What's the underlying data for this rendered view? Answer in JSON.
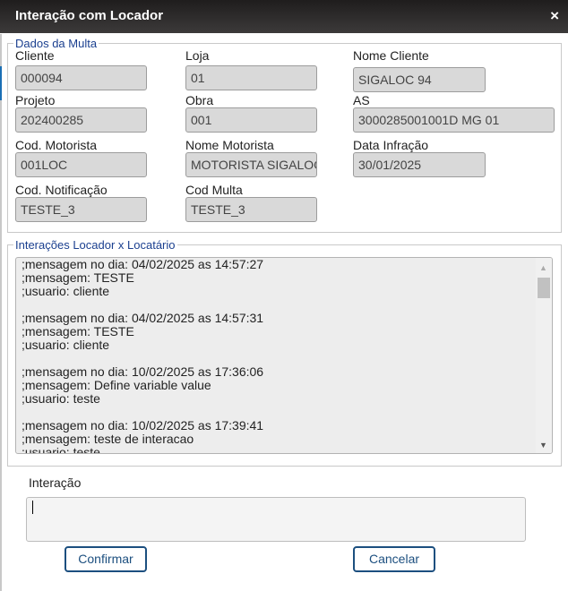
{
  "dialog": {
    "title": "Interação com Locador",
    "close_glyph": "×"
  },
  "fine_details": {
    "legend": "Dados da Multa",
    "fields": {
      "cliente": {
        "label": "Cliente",
        "value": "000094"
      },
      "loja": {
        "label": "Loja",
        "value": "01"
      },
      "nome_cliente": {
        "label": "Nome Cliente",
        "value": "SIGALOC 94"
      },
      "projeto": {
        "label": "Projeto",
        "value": "202400285"
      },
      "obra": {
        "label": "Obra",
        "value": "001"
      },
      "as": {
        "label": "AS",
        "value": "3000285001001D MG 01"
      },
      "cod_motorista": {
        "label": "Cod. Motorista",
        "value": "001LOC"
      },
      "nome_motorista": {
        "label": "Nome Motorista",
        "value": "MOTORISTA SIGALOC"
      },
      "data_infracao": {
        "label": "Data Infração",
        "value": "30/01/2025"
      },
      "cod_notificacao": {
        "label": "Cod. Notificação",
        "value": "TESTE_3"
      },
      "cod_multa": {
        "label": "Cod Multa",
        "value": "TESTE_3"
      }
    }
  },
  "interactions": {
    "legend": "Interações Locador x Locatário",
    "messages": [
      {
        "date_line": ";mensagem no dia: 04/02/2025 as 14:57:27",
        "message_line": ";mensagem: TESTE",
        "user_line": ";usuario: cliente"
      },
      {
        "date_line": ";mensagem no dia: 04/02/2025 as 14:57:31",
        "message_line": ";mensagem: TESTE",
        "user_line": ";usuario: cliente"
      },
      {
        "date_line": ";mensagem no dia: 10/02/2025 as 17:36:06",
        "message_line": ";mensagem: Define variable value",
        "user_line": ";usuario: teste"
      },
      {
        "date_line": ";mensagem no dia: 10/02/2025 as 17:39:41",
        "message_line": ";mensagem: teste de interacao",
        "user_line": ";usuario: teste"
      }
    ]
  },
  "new_interaction": {
    "label": "Interação",
    "value": ""
  },
  "buttons": {
    "confirm": "Confirmar",
    "cancel": "Cancelar"
  },
  "icons": {
    "close": "close-icon",
    "scroll_up": "scroll-up-arrow-icon",
    "scroll_down": "scroll-down-arrow-icon"
  },
  "colors": {
    "titlebar": "#2b2929",
    "legend_text": "#1a3f8f",
    "button_border": "#1c4f7f",
    "readonly_field": "#d9d9d9"
  }
}
